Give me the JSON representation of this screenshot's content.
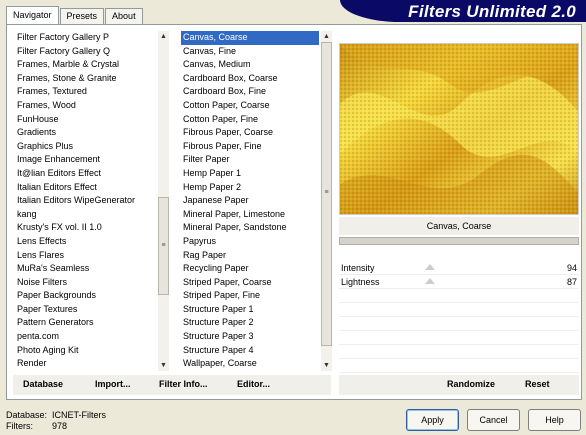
{
  "tabs": [
    "Navigator",
    "Presets",
    "About"
  ],
  "banner_title": "Filters Unlimited 2.0",
  "categories": [
    "Filter Factory Gallery P",
    "Filter Factory Gallery Q",
    "Frames, Marble & Crystal",
    "Frames, Stone & Granite",
    "Frames, Textured",
    "Frames, Wood",
    "FunHouse",
    "Gradients",
    "Graphics Plus",
    "Image Enhancement",
    "It@lian Editors Effect",
    "Italian Editors Effect",
    "Italian Editors WipeGenerator",
    "kang",
    "Krusty's FX vol. II 1.0",
    "Lens Effects",
    "Lens Flares",
    "MuRa's Seamless",
    "Noise Filters",
    "Paper Backgrounds",
    "Paper Textures",
    "Pattern Generators",
    "penta.com",
    "Photo Aging Kit",
    "Render"
  ],
  "filters": [
    "Canvas, Coarse",
    "Canvas, Fine",
    "Canvas, Medium",
    "Cardboard Box, Coarse",
    "Cardboard Box, Fine",
    "Cotton Paper, Coarse",
    "Cotton Paper, Fine",
    "Fibrous Paper, Coarse",
    "Fibrous Paper, Fine",
    "Filter Paper",
    "Hemp Paper 1",
    "Hemp Paper 2",
    "Japanese Paper",
    "Mineral Paper, Limestone",
    "Mineral Paper, Sandstone",
    "Papyrus",
    "Rag Paper",
    "Recycling Paper",
    "Striped Paper, Coarse",
    "Striped Paper, Fine",
    "Structure Paper 1",
    "Structure Paper 2",
    "Structure Paper 3",
    "Structure Paper 4",
    "Wallpaper, Coarse"
  ],
  "selected_filter_index": 0,
  "selected_filter_name": "Canvas, Coarse",
  "params": [
    {
      "label": "Intensity",
      "value": "94"
    },
    {
      "label": "Lightness",
      "value": "87"
    }
  ],
  "toolbar": {
    "database": "Database",
    "import": "Import...",
    "filter_info": "Filter Info...",
    "editor": "Editor...",
    "randomize": "Randomize",
    "reset": "Reset"
  },
  "footer": {
    "database_label": "Database:",
    "database_value": "ICNET-Filters",
    "filters_label": "Filters:",
    "filters_value": "978"
  },
  "buttons": {
    "apply": "Apply",
    "cancel": "Cancel",
    "help": "Help"
  },
  "colors": {
    "selection": "#316ac5",
    "banner": "#0a0a66",
    "preview_gold": "#e9b81a"
  }
}
